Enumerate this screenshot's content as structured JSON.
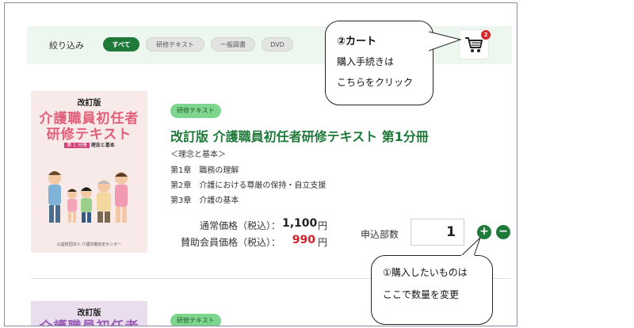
{
  "filters": {
    "label": "絞り込み",
    "chips": [
      {
        "label": "すべて",
        "active": true
      },
      {
        "label": "研修テキスト",
        "active": false
      },
      {
        "label": "一般図書",
        "active": false
      },
      {
        "label": "DVD",
        "active": false
      }
    ]
  },
  "cart": {
    "badge_count": "2",
    "icon": "cart-icon"
  },
  "callouts": {
    "cart": {
      "title": "②カート",
      "line1": "購入手続きは",
      "line2": "こちらをクリック"
    },
    "quantity": {
      "line1": "①購入したいものは",
      "line2": "ここで数量を変更"
    }
  },
  "products": [
    {
      "tag": "研修テキスト",
      "title": "改訂版 介護職員初任者研修テキスト 第1分冊",
      "subtitle": "＜理念と基本＞",
      "chapters": [
        "第1章　職務の理解",
        "第2章　介護における尊厳の保持・自立支援",
        "第3章　介護の基本"
      ],
      "regular_price_label": "通常価格（税込）：",
      "regular_price": "1,100",
      "member_price_label": "賛助会員価格（税込）：",
      "member_price": "990",
      "currency": "円",
      "quantity_label": "申込部数",
      "quantity": "1",
      "cover": {
        "edition": "改訂版",
        "title_line1": "介護職員初任者",
        "title_line2": "研修テキスト",
        "volume": "第 1 分冊",
        "subtitle": "理念と基本",
        "publisher": "公益財団法人 介護労働安定センター"
      }
    },
    {
      "tag": "研修テキスト",
      "cover": {
        "edition": "改訂版",
        "title_line1": "介護職員初任者"
      }
    }
  ],
  "colors": {
    "accent_green": "#1f7a3a",
    "tag_green": "#7ed58e",
    "price_red": "#d0202a",
    "badge_red": "#d6262b"
  }
}
